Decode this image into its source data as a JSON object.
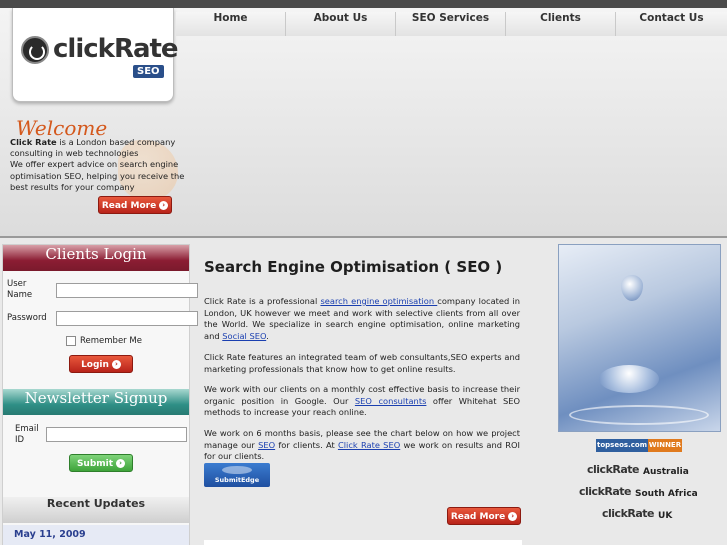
{
  "brand": {
    "name": "clickRate",
    "badge": "SEO"
  },
  "nav": {
    "items": [
      {
        "label": "Home"
      },
      {
        "label": "About Us"
      },
      {
        "label": "SEO Services"
      },
      {
        "label": "Clients"
      },
      {
        "label": "Contact Us"
      }
    ]
  },
  "welcome": {
    "title": "Welcome",
    "brand_bold": "Click Rate",
    "line1_rest": " is a London based company consulting in web technologies",
    "line2": "We offer expert advice on search engine optimisation SEO, helping you receive the best results for your company",
    "read_more": "Read More"
  },
  "login": {
    "title": "Clients Login",
    "user_label": "User Name",
    "password_label": "Password",
    "user_value": "",
    "password_value": "",
    "remember_label": "Remember Me",
    "login_button": "Login"
  },
  "newsletter": {
    "title": "Newsletter Signup",
    "email_label": "Email ID",
    "email_value": "",
    "submit_button": "Submit"
  },
  "updates": {
    "title": "Recent Updates",
    "items": [
      {
        "date": "May 11, 2009"
      }
    ]
  },
  "main": {
    "title": "Search Engine Optimisation ( SEO )",
    "p1": {
      "a": "Click Rate is a professional ",
      "link1": "search engine optimisation ",
      "b": "company located in London, UK however we meet and work with selective clients from all over the World. We specialize in search engine optimisation, online marketing and ",
      "link2": "Social SEO",
      "c": "."
    },
    "p2": "Click Rate features an integrated team of web consultants,SEO experts and marketing professionals that know how to get online results.",
    "p3": {
      "a": "We work with our clients on a monthly cost effective basis to increase their organic position in Google. Our ",
      "link": "SEO consultants",
      "b": " offer Whitehat SEO methods to increase your reach online."
    },
    "p4": {
      "a": "We work on 6 months basis, please see the chart below on how we project manage our ",
      "link1": "SEO",
      "b": " for clients. At ",
      "link2": "Click Rate SEO",
      "c": " we work on results and ROI for our clients."
    },
    "badge": "SubmitEdge",
    "read_more": "Read More"
  },
  "awards": {
    "winner_site": "topseos.com",
    "winner_label": "WINNER",
    "sites": [
      {
        "logo": "clickRate",
        "country": "Australia"
      },
      {
        "logo": "clickRate",
        "country": "South Africa"
      },
      {
        "logo": "clickRate",
        "country": "UK"
      }
    ]
  },
  "colors": {
    "accent": "#d4581c",
    "link": "#1a3fb0",
    "login_header": "#8b1d33",
    "newsletter_header": "#2f8f86",
    "button_red": "#c8321f",
    "button_green": "#4fb34a"
  }
}
